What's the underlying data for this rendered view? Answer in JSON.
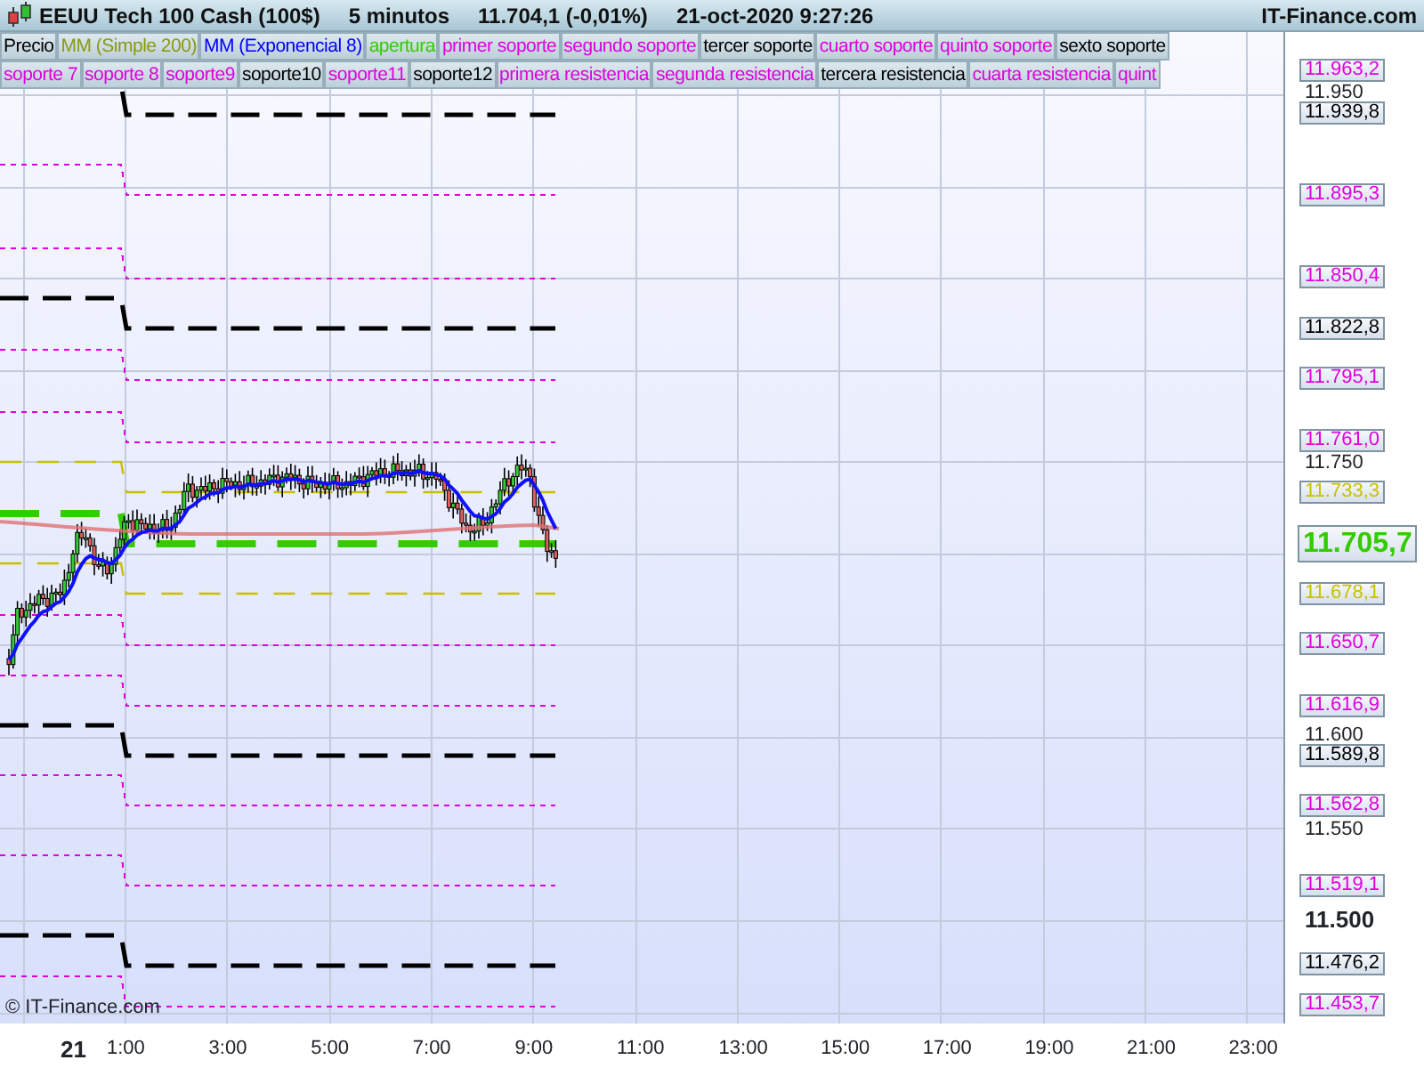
{
  "header": {
    "instrument": "EEUU Tech 100 Cash (100$)",
    "timeframe": "5 minutos",
    "last_price": "11.704,1 (-0,01%)",
    "datetime": "21-oct-2020 9:27:26",
    "brand": "IT-Finance.com"
  },
  "legend_rows": [
    [
      {
        "label": "Precio",
        "color": "#000000"
      },
      {
        "label": "MM (Simple 200)",
        "color": "#8a9a10"
      },
      {
        "label": "MM (Exponencial 8)",
        "color": "#0000ff"
      },
      {
        "label": "apertura",
        "color": "#33cc00"
      },
      {
        "label": "primer soporte",
        "color": "#e000e0"
      },
      {
        "label": "segundo soporte",
        "color": "#e000e0"
      },
      {
        "label": "tercer soporte",
        "color": "#000000"
      },
      {
        "label": "cuarto soporte",
        "color": "#e000e0"
      },
      {
        "label": "quinto soporte",
        "color": "#e000e0"
      },
      {
        "label": "sexto soporte",
        "color": "#000000"
      }
    ],
    [
      {
        "label": "soporte 7",
        "color": "#e000e0"
      },
      {
        "label": "soporte 8",
        "color": "#e000e0"
      },
      {
        "label": "soporte9",
        "color": "#e000e0"
      },
      {
        "label": "soporte10",
        "color": "#000000"
      },
      {
        "label": "soporte11",
        "color": "#e000e0"
      },
      {
        "label": "soporte12",
        "color": "#000000"
      },
      {
        "label": "primera resistencia",
        "color": "#e000e0"
      },
      {
        "label": "segunda resistencia",
        "color": "#e000e0"
      },
      {
        "label": "tercera resistencia",
        "color": "#000000"
      },
      {
        "label": "cuarta resistencia",
        "color": "#e000e0"
      },
      {
        "label": "quint",
        "color": "#e000e0"
      }
    ]
  ],
  "levels": [
    {
      "label": "11.963,2",
      "kind": "minor",
      "color": "#e000e0"
    },
    {
      "label": "11.939,8",
      "kind": "major",
      "color": "#000000"
    },
    {
      "label": "11.895,3",
      "kind": "minor",
      "color": "#e000e0"
    },
    {
      "label": "11.850,4",
      "kind": "minor",
      "color": "#e000e0"
    },
    {
      "label": "11.822,8",
      "kind": "major",
      "color": "#000000"
    },
    {
      "label": "11.795,1",
      "kind": "minor",
      "color": "#e000e0"
    },
    {
      "label": "11.761,0",
      "kind": "minor",
      "color": "#e000e0"
    },
    {
      "label": "11.733,3",
      "kind": "band",
      "color": "#c8c000"
    },
    {
      "label": "11.705,7",
      "kind": "opening",
      "color": "#33cc00"
    },
    {
      "label": "11.678,1",
      "kind": "band",
      "color": "#c8c000"
    },
    {
      "label": "11.650,7",
      "kind": "minor",
      "color": "#e000e0"
    },
    {
      "label": "11.616,9",
      "kind": "minor",
      "color": "#e000e0"
    },
    {
      "label": "11.589,8",
      "kind": "major",
      "color": "#000000"
    },
    {
      "label": "11.562,8",
      "kind": "minor",
      "color": "#e000e0"
    },
    {
      "label": "11.519,1",
      "kind": "minor",
      "color": "#e000e0"
    },
    {
      "label": "11.476,2",
      "kind": "major",
      "color": "#000000"
    },
    {
      "label": "11.453,7",
      "kind": "minor",
      "color": "#e000e0"
    }
  ],
  "price_ticks": [
    {
      "label": "11.950",
      "bold": false
    },
    {
      "label": "11.750",
      "bold": false
    },
    {
      "label": "11.600",
      "bold": false
    },
    {
      "label": "11.550",
      "bold": false
    },
    {
      "label": "11.500",
      "bold": true
    }
  ],
  "time_axis": {
    "day": "21",
    "times": [
      "1:00",
      "3:00",
      "5:00",
      "7:00",
      "9:00",
      "11:00",
      "13:00",
      "15:00",
      "17:00",
      "19:00",
      "21:00",
      "23:00"
    ]
  },
  "copyright": "© IT-Finance.com"
}
